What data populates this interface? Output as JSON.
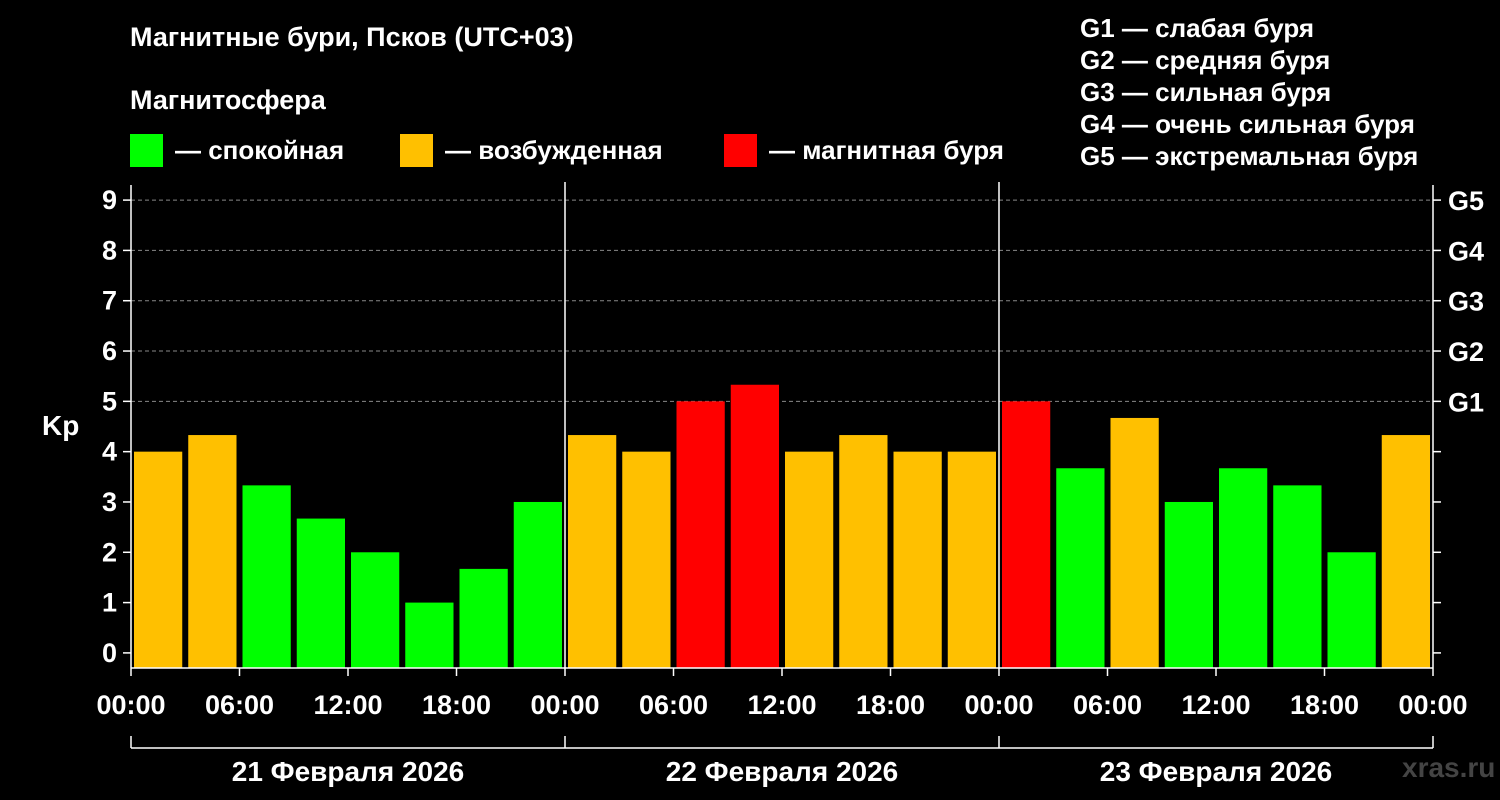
{
  "title": "Магнитные бури, Псков (UTC+03)",
  "subtitle": "Магнитосфера",
  "legend": [
    {
      "label": "— спокойная",
      "color": "#00ff00"
    },
    {
      "label": "— возбужденная",
      "color": "#ffc000"
    },
    {
      "label": "— магнитная буря",
      "color": "#ff0000"
    }
  ],
  "g_legend": [
    "G1 — слабая буря",
    "G2 — средняя буря",
    "G3 — сильная буря",
    "G4 — очень сильная буря",
    "G5 — экстремальная буря"
  ],
  "watermark": "xras.ru",
  "chart_data": {
    "type": "bar",
    "ylabel": "Kp",
    "ylim": [
      -0.3,
      9.3
    ],
    "yticks": [
      0,
      1,
      2,
      3,
      4,
      5,
      6,
      7,
      8,
      9
    ],
    "right_ticks": [
      {
        "value": 5,
        "label": "G1"
      },
      {
        "value": 6,
        "label": "G2"
      },
      {
        "value": 7,
        "label": "G3"
      },
      {
        "value": 8,
        "label": "G4"
      },
      {
        "value": 9,
        "label": "G5"
      }
    ],
    "x_tick_labels": [
      "00:00",
      "06:00",
      "12:00",
      "18:00",
      "00:00",
      "06:00",
      "12:00",
      "18:00",
      "00:00",
      "06:00",
      "12:00",
      "18:00",
      "00:00"
    ],
    "days": [
      "21 Февраля 2026",
      "22 Февраля 2026",
      "23 Февраля 2026"
    ],
    "grid": true,
    "bars": [
      {
        "day": 0,
        "start_hour": 0,
        "value": 4.0,
        "level": "excited"
      },
      {
        "day": 0,
        "start_hour": 3,
        "value": 4.33,
        "level": "excited"
      },
      {
        "day": 0,
        "start_hour": 6,
        "value": 3.33,
        "level": "quiet"
      },
      {
        "day": 0,
        "start_hour": 9,
        "value": 2.67,
        "level": "quiet"
      },
      {
        "day": 0,
        "start_hour": 12,
        "value": 2.0,
        "level": "quiet"
      },
      {
        "day": 0,
        "start_hour": 15,
        "value": 1.0,
        "level": "quiet"
      },
      {
        "day": 0,
        "start_hour": 18,
        "value": 1.67,
        "level": "quiet"
      },
      {
        "day": 0,
        "start_hour": 21,
        "value": 3.0,
        "level": "quiet"
      },
      {
        "day": 1,
        "start_hour": 0,
        "value": 4.33,
        "level": "excited"
      },
      {
        "day": 1,
        "start_hour": 3,
        "value": 4.0,
        "level": "excited"
      },
      {
        "day": 1,
        "start_hour": 6,
        "value": 5.0,
        "level": "storm"
      },
      {
        "day": 1,
        "start_hour": 9,
        "value": 5.33,
        "level": "storm"
      },
      {
        "day": 1,
        "start_hour": 12,
        "value": 4.0,
        "level": "excited"
      },
      {
        "day": 1,
        "start_hour": 15,
        "value": 4.33,
        "level": "excited"
      },
      {
        "day": 1,
        "start_hour": 18,
        "value": 4.0,
        "level": "excited"
      },
      {
        "day": 1,
        "start_hour": 21,
        "value": 4.0,
        "level": "excited"
      },
      {
        "day": 2,
        "start_hour": 0,
        "value": 5.0,
        "level": "storm"
      },
      {
        "day": 2,
        "start_hour": 3,
        "value": 3.67,
        "level": "quiet"
      },
      {
        "day": 2,
        "start_hour": 6,
        "value": 4.67,
        "level": "excited"
      },
      {
        "day": 2,
        "start_hour": 9,
        "value": 3.0,
        "level": "quiet"
      },
      {
        "day": 2,
        "start_hour": 12,
        "value": 3.67,
        "level": "quiet"
      },
      {
        "day": 2,
        "start_hour": 15,
        "value": 3.33,
        "level": "quiet"
      },
      {
        "day": 2,
        "start_hour": 18,
        "value": 2.0,
        "level": "quiet"
      },
      {
        "day": 2,
        "start_hour": 21,
        "value": 4.33,
        "level": "excited"
      }
    ],
    "level_colors": {
      "quiet": "#00ff00",
      "excited": "#ffc000",
      "storm": "#ff0000"
    }
  }
}
